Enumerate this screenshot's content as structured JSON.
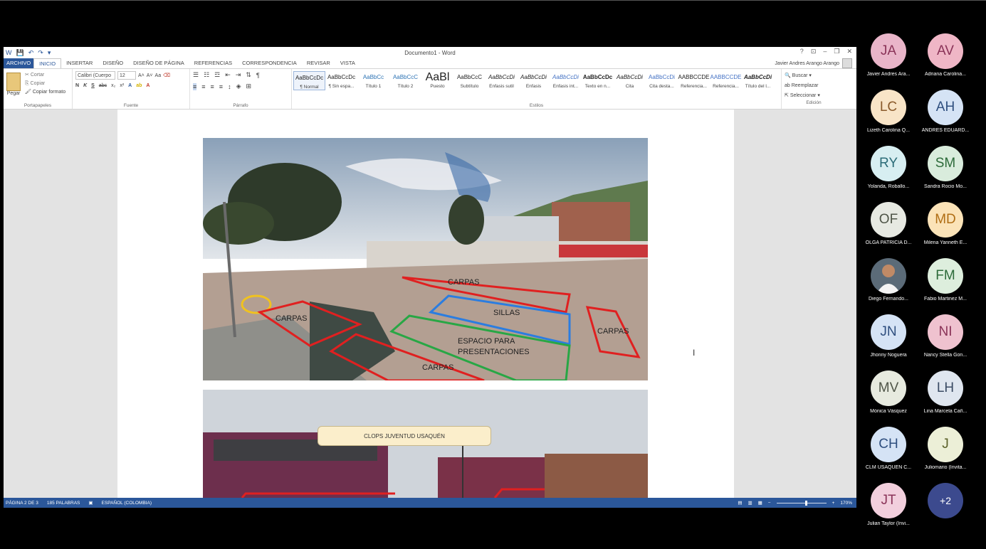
{
  "word": {
    "doc_title": "Documento1 - Word",
    "user_name": "Javier Andres Arango Arango",
    "window_controls": [
      "?",
      "⊡",
      "–",
      "❐",
      "✕"
    ],
    "tabs": [
      "ARCHIVO",
      "INICIO",
      "INSERTAR",
      "DISEÑO",
      "DISEÑO DE PÁGINA",
      "REFERENCIAS",
      "CORRESPONDENCIA",
      "REVISAR",
      "VISTA"
    ],
    "clipboard": {
      "paste": "Pegar",
      "cut": "Cortar",
      "copy": "Copiar",
      "format": "Copiar formato",
      "label": "Portapapeles"
    },
    "font": {
      "name": "Calibri (Cuerpo",
      "size": "12",
      "label": "Fuente"
    },
    "paragraph_label": "Párrafo",
    "styles": [
      {
        "sample": "AaBbCcDc",
        "name": "¶ Normal"
      },
      {
        "sample": "AaBbCcDc",
        "name": "¶ Sin espa..."
      },
      {
        "sample": "AaBbCc",
        "name": "Título 1"
      },
      {
        "sample": "AaBbCcC",
        "name": "Título 2"
      },
      {
        "sample": "AaBl",
        "name": "Puesto"
      },
      {
        "sample": "AaBbCcC",
        "name": "Subtítulo"
      },
      {
        "sample": "AaBbCcDi",
        "name": "Énfasis sutil"
      },
      {
        "sample": "AaBbCcDi",
        "name": "Énfasis"
      },
      {
        "sample": "AaBbCcDi",
        "name": "Énfasis int..."
      },
      {
        "sample": "AaBbCcDc",
        "name": "Texto en n..."
      },
      {
        "sample": "AaBbCcDi",
        "name": "Cita"
      },
      {
        "sample": "AaBbCcDi",
        "name": "Cita desta..."
      },
      {
        "sample": "AABBCCDE",
        "name": "Referencia..."
      },
      {
        "sample": "AABBCCDE",
        "name": "Referencia..."
      },
      {
        "sample": "AaBbCcDi",
        "name": "Título del l..."
      }
    ],
    "styles_label": "Estilos",
    "editing": {
      "find": "Buscar",
      "replace": "Reemplazar",
      "select": "Seleccionar",
      "label": "Edición"
    },
    "image_labels": {
      "carpas_top": "CARPAS",
      "carpas_left": "CARPAS",
      "sillas": "SILLAS",
      "carpas_right": "CARPAS",
      "espacio": "ESPACIO PARA",
      "presentaciones": "PRESENTACIONES",
      "carpas_bottom": "CARPAS"
    },
    "caption": "CLOPS JUVENTUD USAQUÉN",
    "status": {
      "page": "PÁGINA 2 DE 3",
      "words": "185 PALABRAS",
      "language": "ESPAÑOL (COLOMBIA)",
      "zoom": "170%"
    }
  },
  "participants": [
    {
      "initials": "JA",
      "name": "Javier Andres Ara...",
      "color": "#e9b5c9",
      "text": "#8a3358"
    },
    {
      "initials": "AV",
      "name": "Adriana Carolina...",
      "color": "#efb6c6",
      "text": "#8a3358"
    },
    {
      "initials": "LC",
      "name": "Lizeth Carolina Q...",
      "color": "#f8e4c7",
      "text": "#8a5a2b"
    },
    {
      "initials": "AH",
      "name": "ANDRES EDUARD...",
      "color": "#d5e3f5",
      "text": "#2f4f7f"
    },
    {
      "initials": "RY",
      "name": "Yolanda, Roballo...",
      "color": "#d7eef1",
      "text": "#2b6c78"
    },
    {
      "initials": "SM",
      "name": "Sandra Rocio Mo...",
      "color": "#d9ecdc",
      "text": "#2d6b3a"
    },
    {
      "initials": "OF",
      "name": "OLGA PATRICIA D...",
      "color": "#e7e9e2",
      "text": "#4f5548"
    },
    {
      "initials": "MD",
      "name": "Milena Yanneth E...",
      "color": "#fbe3b8",
      "text": "#b06e14"
    },
    {
      "initials": "",
      "name": "Diego Fernando...",
      "color": "#5b6b78",
      "text": "#ffffff"
    },
    {
      "initials": "FM",
      "name": "Fabio Martinez M...",
      "color": "#ddeedd",
      "text": "#2d6b3a"
    },
    {
      "initials": "JN",
      "name": "Jhonny Noguera",
      "color": "#d5e3f5",
      "text": "#2f4f7f"
    },
    {
      "initials": "NI",
      "name": "Nancy Stella Gon...",
      "color": "#efc2cf",
      "text": "#8a3358"
    },
    {
      "initials": "MV",
      "name": "Mónica Vásquez",
      "color": "#e7eadf",
      "text": "#4f5548"
    },
    {
      "initials": "LH",
      "name": "Lina Marcela Cañ...",
      "color": "#dfe6ef",
      "text": "#3a4b63"
    },
    {
      "initials": "CH",
      "name": "CLM USAQUEN C...",
      "color": "#d5e3f5",
      "text": "#2f4f7f"
    },
    {
      "initials": "J",
      "name": "Juliomario (Invita...",
      "color": "#ecefd7",
      "text": "#5b6129"
    },
    {
      "initials": "JT",
      "name": "Julian Taylor (Invi...",
      "color": "#f2cfdd",
      "text": "#8a3358"
    },
    {
      "initials": "+2",
      "name": "",
      "color": "#3c4a8e",
      "text": "#ffffff"
    }
  ]
}
